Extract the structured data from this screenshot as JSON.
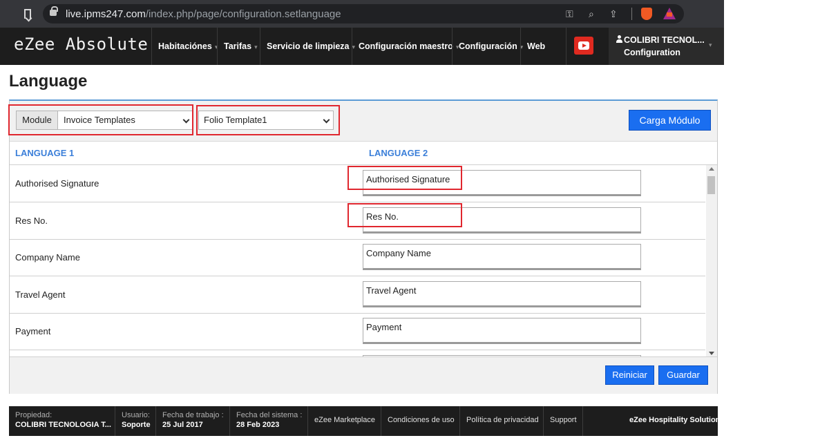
{
  "browser": {
    "url_host": "live.ipms247.com",
    "url_path": "/index.php/page/configuration.setlanguage"
  },
  "nav": {
    "brand": "eZee Absolute",
    "items": [
      {
        "label": "Habitaciónes"
      },
      {
        "label": "Tarifas"
      },
      {
        "label": "Servicio de limpieza"
      },
      {
        "label": "Configuración maestro"
      },
      {
        "label": "Configuración"
      },
      {
        "label": "Web"
      }
    ],
    "user_name": "COLIBRI TECNOL...",
    "user_sub": "Configuration"
  },
  "page": {
    "title": "Language",
    "module_label": "Module",
    "module_value": "Invoice Templates",
    "template_value": "Folio Template1",
    "load_button": "Carga Módulo",
    "col1_header": "LANGUAGE 1",
    "col2_header": "LANGUAGE 2",
    "rows": [
      {
        "label": "Authorised Signature",
        "value": "Authorised Signature"
      },
      {
        "label": "Res No.",
        "value": "Res No."
      },
      {
        "label": "Company Name",
        "value": "Company Name"
      },
      {
        "label": "Travel Agent",
        "value": "Travel Agent"
      },
      {
        "label": "Payment",
        "value": "Payment"
      }
    ],
    "reset_button": "Reiniciar",
    "save_button": "Guardar"
  },
  "footer": {
    "property_label": "Propiedad:",
    "property_value": "COLIBRI TECNOLOGIA T...",
    "user_label": "Usuario:",
    "user_value": "Soporte",
    "workdate_label": "Fecha de trabajo :",
    "workdate_value": "25 Jul 2017",
    "sysdate_label": "Fecha del sistema :",
    "sysdate_value": "28 Feb 2023",
    "links": [
      "eZee Marketplace",
      "Condiciones de uso",
      "Política de privacidad",
      "Support"
    ],
    "brand": "eZee Hospitality Solution"
  }
}
